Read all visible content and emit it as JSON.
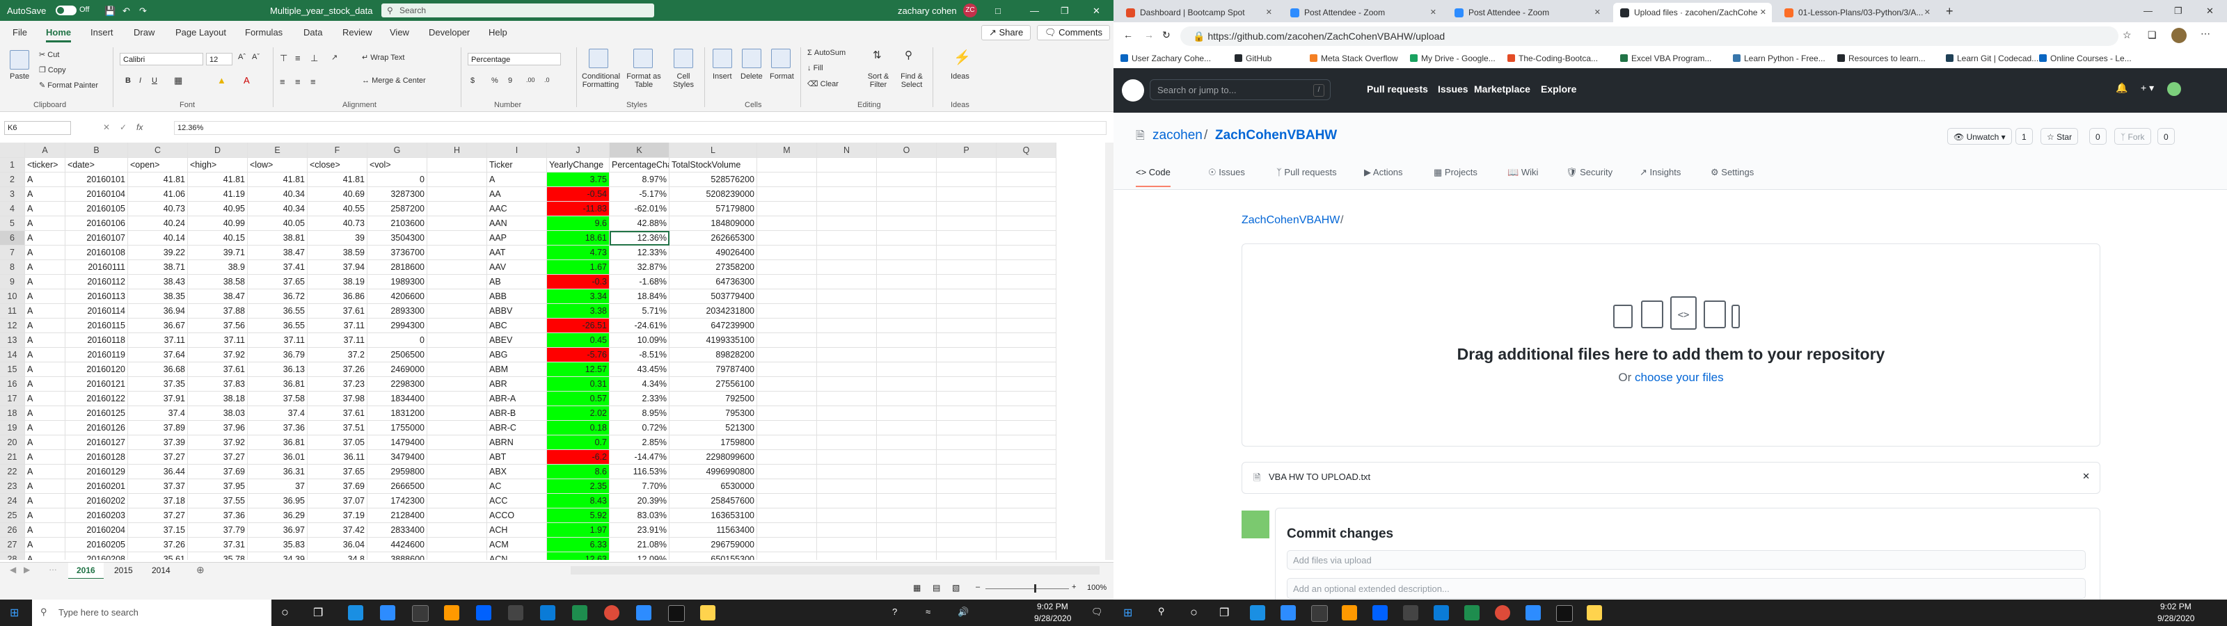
{
  "excel": {
    "autosave_label": "AutoSave",
    "autosave_state": "Off",
    "title": "Multiple_year_stock_data",
    "search_placeholder": "Search",
    "user": "zachary cohen",
    "user_initials": "ZC",
    "menu_tabs": [
      "File",
      "Home",
      "Insert",
      "Draw",
      "Page Layout",
      "Formulas",
      "Data",
      "Review",
      "View",
      "Developer",
      "Help"
    ],
    "share_label": "Share",
    "comments_label": "Comments",
    "ribbon": {
      "paste": "Paste",
      "cut": "Cut",
      "copy": "Copy",
      "format_painter": "Format Painter",
      "clipboard": "Clipboard",
      "font_name": "Calibri",
      "font_size": "12",
      "font": "Font",
      "wrap_text": "Wrap Text",
      "merge_center": "Merge & Center",
      "alignment": "Alignment",
      "number_format": "Percentage",
      "number": "Number",
      "conditional_formatting": "Conditional Formatting",
      "format_as_table": "Format as Table",
      "cell_styles": "Cell Styles",
      "styles": "Styles",
      "insert": "Insert",
      "delete": "Delete",
      "format": "Format",
      "cells": "Cells",
      "autosum": "AutoSum",
      "fill": "Fill",
      "clear": "Clear",
      "sort_filter": "Sort & Filter",
      "find_select": "Find & Select",
      "editing": "Editing",
      "ideas": "Ideas",
      "ideas_group": "Ideas"
    },
    "name_box": "K6",
    "formula_value": "12.36%",
    "columns": [
      "A",
      "B",
      "C",
      "D",
      "E",
      "F",
      "G",
      "H",
      "I",
      "J",
      "K",
      "L",
      "M",
      "N",
      "O",
      "P",
      "Q"
    ],
    "headers": [
      "<ticker>",
      "<date>",
      "<open>",
      "<high>",
      "<low>",
      "<close>",
      "<vol>",
      "",
      "Ticker",
      "YearlyChange",
      "PercentageChange",
      "TotalStockVolume"
    ],
    "rows": [
      [
        "A",
        "20160101",
        "41.81",
        "41.81",
        "41.81",
        "41.81",
        "0",
        "",
        "A",
        "3.75",
        "8.97%",
        "528576200"
      ],
      [
        "A",
        "20160104",
        "41.06",
        "41.19",
        "40.34",
        "40.69",
        "3287300",
        "",
        "AA",
        "-0.54",
        "-5.17%",
        "5208239000"
      ],
      [
        "A",
        "20160105",
        "40.73",
        "40.95",
        "40.34",
        "40.55",
        "2587200",
        "",
        "AAC",
        "-11.83",
        "-62.01%",
        "57179800"
      ],
      [
        "A",
        "20160106",
        "40.24",
        "40.99",
        "40.05",
        "40.73",
        "2103600",
        "",
        "AAN",
        "9.6",
        "42.88%",
        "184809000"
      ],
      [
        "A",
        "20160107",
        "40.14",
        "40.15",
        "38.81",
        "39",
        "3504300",
        "",
        "AAP",
        "18.61",
        "12.36%",
        "262665300"
      ],
      [
        "A",
        "20160108",
        "39.22",
        "39.71",
        "38.47",
        "38.59",
        "3736700",
        "",
        "AAT",
        "4.73",
        "12.33%",
        "49026400"
      ],
      [
        "A",
        "20160111",
        "38.71",
        "38.9",
        "37.41",
        "37.94",
        "2818600",
        "",
        "AAV",
        "1.67",
        "32.87%",
        "27358200"
      ],
      [
        "A",
        "20160112",
        "38.43",
        "38.58",
        "37.65",
        "38.19",
        "1989300",
        "",
        "AB",
        "-0.3",
        "-1.68%",
        "64736300"
      ],
      [
        "A",
        "20160113",
        "38.35",
        "38.47",
        "36.72",
        "36.86",
        "4206600",
        "",
        "ABB",
        "3.34",
        "18.84%",
        "503779400"
      ],
      [
        "A",
        "20160114",
        "36.94",
        "37.88",
        "36.55",
        "37.61",
        "2893300",
        "",
        "ABBV",
        "3.38",
        "5.71%",
        "2034231800"
      ],
      [
        "A",
        "20160115",
        "36.67",
        "37.56",
        "36.55",
        "37.11",
        "2994300",
        "",
        "ABC",
        "-26.51",
        "-24.61%",
        "647239900"
      ],
      [
        "A",
        "20160118",
        "37.11",
        "37.11",
        "37.11",
        "37.11",
        "0",
        "",
        "ABEV",
        "0.45",
        "10.09%",
        "4199335100"
      ],
      [
        "A",
        "20160119",
        "37.64",
        "37.92",
        "36.79",
        "37.2",
        "2506500",
        "",
        "ABG",
        "-5.76",
        "-8.51%",
        "89828200"
      ],
      [
        "A",
        "20160120",
        "36.68",
        "37.61",
        "36.13",
        "37.26",
        "2469000",
        "",
        "ABM",
        "12.57",
        "43.45%",
        "79787400"
      ],
      [
        "A",
        "20160121",
        "37.35",
        "37.83",
        "36.81",
        "37.23",
        "2298300",
        "",
        "ABR",
        "0.31",
        "4.34%",
        "27556100"
      ],
      [
        "A",
        "20160122",
        "37.91",
        "38.18",
        "37.58",
        "37.98",
        "1834400",
        "",
        "ABR-A",
        "0.57",
        "2.33%",
        "792500"
      ],
      [
        "A",
        "20160125",
        "37.4",
        "38.03",
        "37.4",
        "37.61",
        "1831200",
        "",
        "ABR-B",
        "2.02",
        "8.95%",
        "795300"
      ],
      [
        "A",
        "20160126",
        "37.89",
        "37.96",
        "37.36",
        "37.51",
        "1755000",
        "",
        "ABR-C",
        "0.18",
        "0.72%",
        "521300"
      ],
      [
        "A",
        "20160127",
        "37.39",
        "37.92",
        "36.81",
        "37.05",
        "1479400",
        "",
        "ABRN",
        "0.7",
        "2.85%",
        "1759800"
      ],
      [
        "A",
        "20160128",
        "37.27",
        "37.27",
        "36.01",
        "36.11",
        "3479400",
        "",
        "ABT",
        "-6.2",
        "-14.47%",
        "2298099600"
      ],
      [
        "A",
        "20160129",
        "36.44",
        "37.69",
        "36.31",
        "37.65",
        "2959800",
        "",
        "ABX",
        "8.6",
        "116.53%",
        "4996990800"
      ],
      [
        "A",
        "20160201",
        "37.37",
        "37.95",
        "37",
        "37.69",
        "2666500",
        "",
        "AC",
        "2.35",
        "7.70%",
        "6530000"
      ],
      [
        "A",
        "20160202",
        "37.18",
        "37.55",
        "36.95",
        "37.07",
        "1742300",
        "",
        "ACC",
        "8.43",
        "20.39%",
        "258457600"
      ],
      [
        "A",
        "20160203",
        "37.27",
        "37.36",
        "36.29",
        "37.19",
        "2128400",
        "",
        "ACCO",
        "5.92",
        "83.03%",
        "163653100"
      ],
      [
        "A",
        "20160204",
        "37.15",
        "37.79",
        "36.97",
        "37.42",
        "2833400",
        "",
        "ACH",
        "1.97",
        "23.91%",
        "11563400"
      ],
      [
        "A",
        "20160205",
        "37.26",
        "37.31",
        "35.83",
        "36.04",
        "4424600",
        "",
        "ACM",
        "6.33",
        "21.08%",
        "296759000"
      ],
      [
        "A",
        "20160208",
        "35.61",
        "35.78",
        "34.39",
        "34.8",
        "3888600",
        "",
        "ACN",
        "12.63",
        "12.09%",
        "650155300"
      ]
    ],
    "sheets": [
      "2016",
      "2015",
      "2014"
    ],
    "zoom": "100%"
  },
  "browser": {
    "tabs": [
      {
        "title": "Dashboard | Bootcamp Spot",
        "color": "#e34c26"
      },
      {
        "title": "Post Attendee - Zoom",
        "color": "#2d8cff"
      },
      {
        "title": "Post Attendee - Zoom",
        "color": "#2d8cff"
      },
      {
        "title": "Upload files · zacohen/ZachCohe",
        "color": "#24292e"
      },
      {
        "title": "01-Lesson-Plans/03-Python/3/A...",
        "color": "#fc6d26"
      }
    ],
    "url": "https://github.com/zacohen/ZachCohenVBAHW/upload",
    "bookmarks": [
      "User Zachary Cohe...",
      "GitHub",
      "Meta Stack Overflow",
      "My Drive - Google...",
      "The-Coding-Bootca...",
      "Excel VBA Program...",
      "Learn Python - Free...",
      "Resources to learn...",
      "Learn Git | Codecad...",
      "Online Courses - Le..."
    ],
    "github": {
      "search_placeholder": "Search or jump to...",
      "search_shortcut": "/",
      "nav": [
        "Pull requests",
        "Issues",
        "Marketplace",
        "Explore"
      ],
      "owner": "zacohen",
      "repo": "ZachCohenVBAHW",
      "unwatch_label": "Unwatch",
      "unwatch_count": "1",
      "star_label": "Star",
      "star_count": "0",
      "fork_label": "Fork",
      "fork_count": "0",
      "repo_tabs": [
        "Code",
        "Issues",
        "Pull requests",
        "Actions",
        "Projects",
        "Wiki",
        "Security",
        "Insights",
        "Settings"
      ],
      "breadcrumb": "ZachCohenVBAHW",
      "breadcrumb_sep": "/",
      "drop_text": "Drag additional files here to add them to your repository",
      "or_text": "Or",
      "choose_files": "choose your files",
      "file_name": "VBA HW TO UPLOAD.txt",
      "commit_heading": "Commit changes",
      "commit_placeholder": "Add files via upload",
      "commit_desc_placeholder": "Add an optional extended description..."
    }
  },
  "taskbar": {
    "search_placeholder": "Type here to search",
    "time": "9:02 PM",
    "date": "9/28/2020"
  }
}
